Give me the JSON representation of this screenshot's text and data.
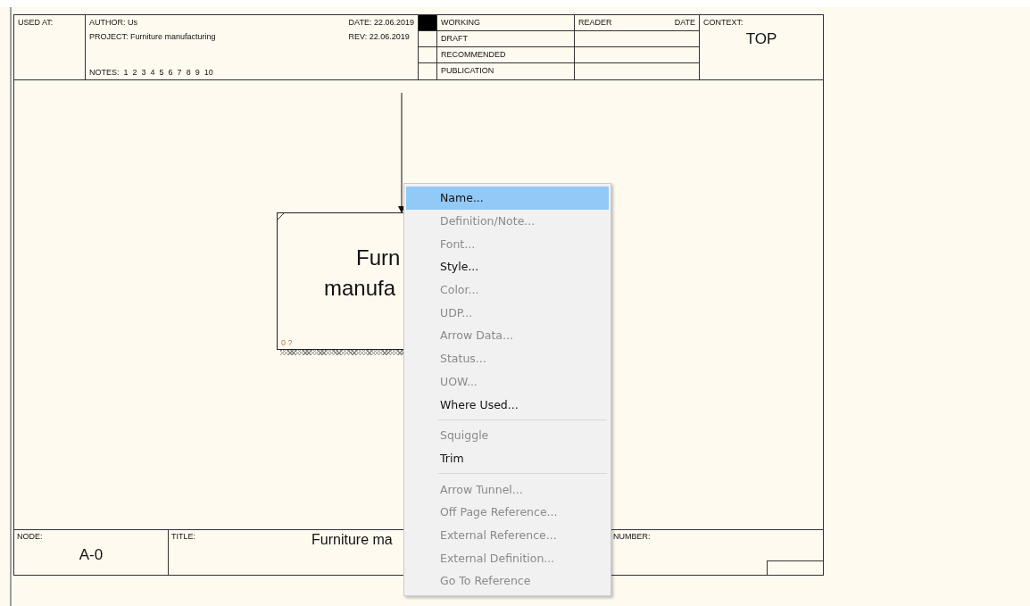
{
  "header": {
    "used_at_label": "USED AT:",
    "author": "AUTHOR:  Us",
    "project": "PROJECT:  Furniture manufacturing",
    "notes_label": "NOTES:",
    "notes": [
      "1",
      "2",
      "3",
      "4",
      "5",
      "6",
      "7",
      "8",
      "9",
      "10"
    ],
    "date": "DATE:  22.06.2019",
    "rev": "REV:   22.06.2019",
    "statuses": [
      {
        "label": "WORKING",
        "selected": true
      },
      {
        "label": "DRAFT",
        "selected": false
      },
      {
        "label": "RECOMMENDED",
        "selected": false
      },
      {
        "label": "PUBLICATION",
        "selected": false
      }
    ],
    "reader_label": "READER",
    "reader_date_label": "DATE",
    "context_label": "CONTEXT:",
    "context_value": "TOP"
  },
  "canvas": {
    "box": {
      "title_lines": [
        "Furn",
        "manufa"
      ],
      "number": "0 ?"
    }
  },
  "footer": {
    "node_label": "NODE:",
    "node_value": "A-0",
    "title_label": "TITLE:",
    "title_value": "Furniture ma",
    "number_label": "NUMBER:"
  },
  "context_menu": {
    "items": [
      {
        "kind": "item",
        "label": "Name...",
        "enabled": true,
        "selected": true
      },
      {
        "kind": "item",
        "label": "Definition/Note...",
        "enabled": false,
        "selected": false
      },
      {
        "kind": "item",
        "label": "Font...",
        "enabled": false,
        "selected": false
      },
      {
        "kind": "item",
        "label": "Style...",
        "enabled": true,
        "selected": false
      },
      {
        "kind": "item",
        "label": "Color...",
        "enabled": false,
        "selected": false
      },
      {
        "kind": "item",
        "label": "UDP...",
        "enabled": false,
        "selected": false
      },
      {
        "kind": "item",
        "label": "Arrow Data...",
        "enabled": false,
        "selected": false
      },
      {
        "kind": "item",
        "label": "Status...",
        "enabled": false,
        "selected": false
      },
      {
        "kind": "item",
        "label": "UOW...",
        "enabled": false,
        "selected": false
      },
      {
        "kind": "item",
        "label": "Where Used...",
        "enabled": true,
        "selected": false
      },
      {
        "kind": "separator"
      },
      {
        "kind": "item",
        "label": "Squiggle",
        "enabled": false,
        "selected": false
      },
      {
        "kind": "item",
        "label": "Trim",
        "enabled": true,
        "selected": false
      },
      {
        "kind": "separator"
      },
      {
        "kind": "item",
        "label": "Arrow Tunnel...",
        "enabled": false,
        "selected": false
      },
      {
        "kind": "item",
        "label": "Off Page Reference...",
        "enabled": false,
        "selected": false
      },
      {
        "kind": "item",
        "label": "External Reference...",
        "enabled": false,
        "selected": false
      },
      {
        "kind": "item",
        "label": "External Definition...",
        "enabled": false,
        "selected": false
      },
      {
        "kind": "item",
        "label": "Go To Reference",
        "enabled": false,
        "selected": false
      }
    ]
  }
}
